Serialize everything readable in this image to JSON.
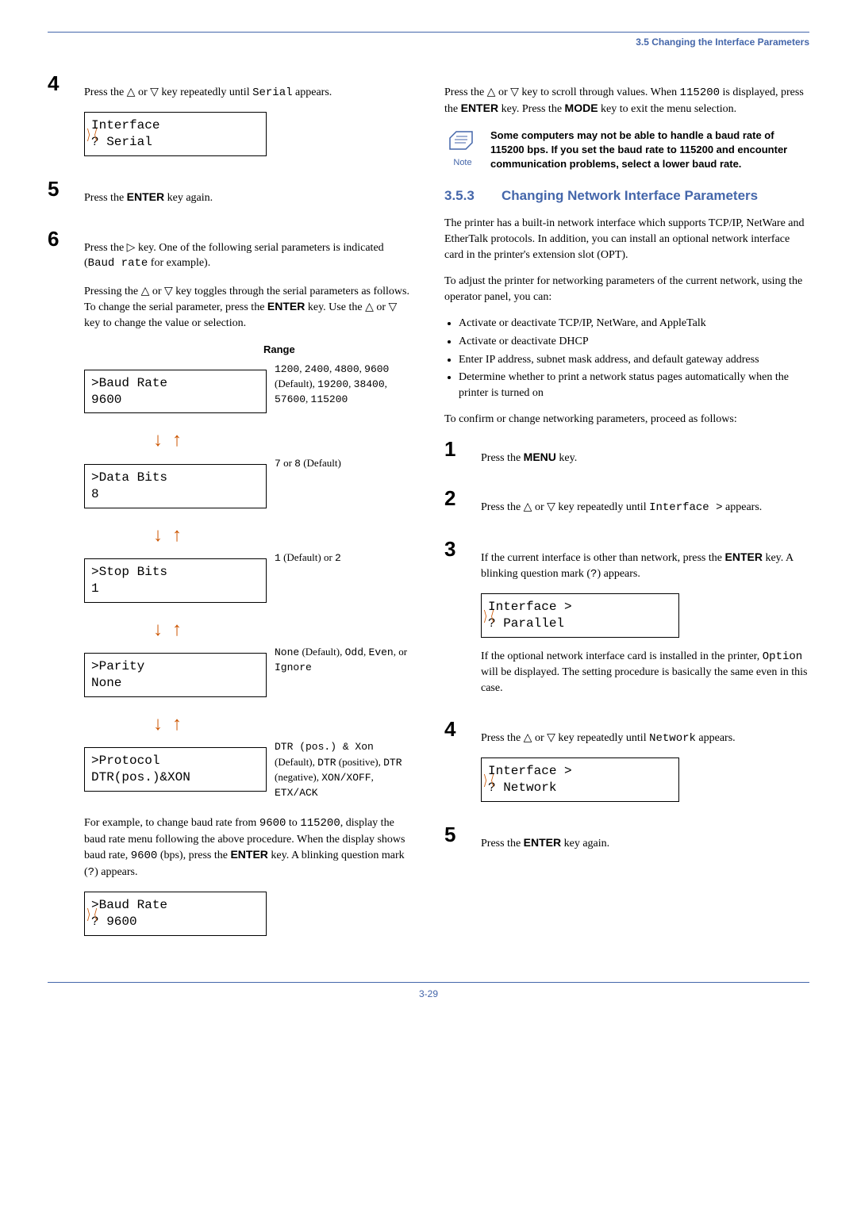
{
  "header": {
    "title": "3.5 Changing the Interface Parameters"
  },
  "left": {
    "step4": {
      "text_a": "Press the ",
      "text_b": " or ",
      "text_c": " key repeatedly until ",
      "serial": "Serial",
      "text_d": " appears.",
      "lcd_l1": " Interface",
      "lcd_l2": "? Serial"
    },
    "step5": {
      "text_a": "Press the ",
      "enter": "ENTER",
      "text_b": " key again."
    },
    "step6": {
      "text_a": "Press the ",
      "text_b": " key. One of the following serial parameters is indicated (",
      "baud": "Baud rate",
      "text_c": " for example).",
      "p2a": "Pressing the ",
      "p2b": " or ",
      "p2c": " key toggles through the serial parameters as follows. To change the serial parameter, press the ",
      "enter": "ENTER",
      "p2d": " key. Use the ",
      "p2e": " or ",
      "p2f": " key to change the value or selection."
    },
    "range_header": "Range",
    "rows": [
      {
        "l1": ">Baud Rate",
        "l2": "   9600",
        "r_a": "1200",
        "r_b": ", ",
        "r_c": "2400",
        "r_d": ", ",
        "r_e": "4800",
        "r_f": ", ",
        "r_g": "9600",
        "r_h": " (Default), ",
        "r_i": "19200",
        "r_j": ", ",
        "r_k": "38400",
        "r_l": ", ",
        "r_m": "57600",
        "r_n": ", ",
        "r_o": "115200"
      },
      {
        "l1": ">Data Bits",
        "l2": " 8",
        "r_a": "7",
        "r_b": " or ",
        "r_c": "8",
        "r_d": " (Default)"
      },
      {
        "l1": ">Stop Bits",
        "l2": " 1",
        "r_a": "1",
        "r_b": " (Default) or ",
        "r_c": "2"
      },
      {
        "l1": ">Parity",
        "l2": " None",
        "r_a": "None",
        "r_b": " (Default), ",
        "r_c": "Odd",
        "r_d": ", ",
        "r_e": "Even",
        "r_f": ", or ",
        "r_g": "Ignore"
      },
      {
        "l1": ">Protocol",
        "l2": " DTR(pos.)&XON",
        "r_a": "DTR (pos.) & Xon",
        "r_b": " (Default), ",
        "r_c": "DTR",
        "r_d": " (positive), ",
        "r_e": "DTR",
        "r_f": " (negative), ",
        "r_g": "XON/XOFF",
        "r_h": ", ",
        "r_i": "ETX/ACK"
      }
    ],
    "para2": {
      "a": "For example, to change baud rate from ",
      "v1": "9600",
      "b": " to ",
      "v2": "115200",
      "c": ", display the baud rate menu following the above procedure. When the display shows baud rate, ",
      "v3": "9600",
      "d": " (bps), press the ",
      "enter": "ENTER",
      "e": " key. A blinking question mark (",
      "q": "?",
      "f": ") appears."
    },
    "lcd2_l1": ">Baud Rate",
    "lcd2_l2": "?   9600"
  },
  "right": {
    "para1": {
      "a": "Press the ",
      "b": " or ",
      "c": " key to scroll through values. When ",
      "v": "115200",
      "d": " is displayed, press the ",
      "enter": "ENTER",
      "e": " key. Press the ",
      "mode": "MODE",
      "f": " key to exit the menu selection."
    },
    "note_label": "Note",
    "note_text": "Some computers may not be able to handle a baud rate of 115200 bps. If you set the baud rate to 115200 and encounter communication problems, select a lower baud rate.",
    "section": {
      "num": "3.5.3",
      "title": "Changing Network Interface Parameters"
    },
    "para2": "The printer has a built-in network interface which supports TCP/IP, NetWare and EtherTalk protocols. In addition, you can install an optional network interface card in the printer's extension slot (OPT).",
    "para3": "To adjust the printer for networking parameters of the current network, using the operator panel, you can:",
    "bullets": [
      "Activate or deactivate TCP/IP, NetWare, and AppleTalk",
      "Activate or deactivate DHCP",
      "Enter IP address, subnet mask address, and default gateway address",
      "Determine whether to print a network status pages automatically when the printer is turned on"
    ],
    "para4": "To confirm or change networking parameters, proceed as follows:",
    "step1": {
      "a": "Press the ",
      "menu": "MENU",
      "b": " key."
    },
    "step2": {
      "a": "Press the ",
      "b": " or ",
      "c": " key repeatedly until ",
      "iface": "Interface >",
      "d": " appears."
    },
    "step3": {
      "a": "If the current interface is other than network, press the ",
      "enter": "ENTER",
      "b": " key. A blinking question mark (",
      "q": "?",
      "c": ") appears.",
      "lcd_l1": " Interface        >",
      "lcd_l2": "? Parallel",
      "p2a": "If the optional network interface card is installed in the printer, ",
      "opt": "Option",
      "p2b": " will be displayed. The setting procedure is basically the same even in this case."
    },
    "step4": {
      "a": "Press the ",
      "b": " or ",
      "c": " key repeatedly until ",
      "nw": "Network",
      "d": " appears.",
      "lcd_l1": " Interface        >",
      "lcd_l2": "? Network"
    },
    "step5": {
      "a": "Press the ",
      "enter": "ENTER",
      "b": " key again."
    }
  },
  "footer": {
    "page": "3-29"
  }
}
